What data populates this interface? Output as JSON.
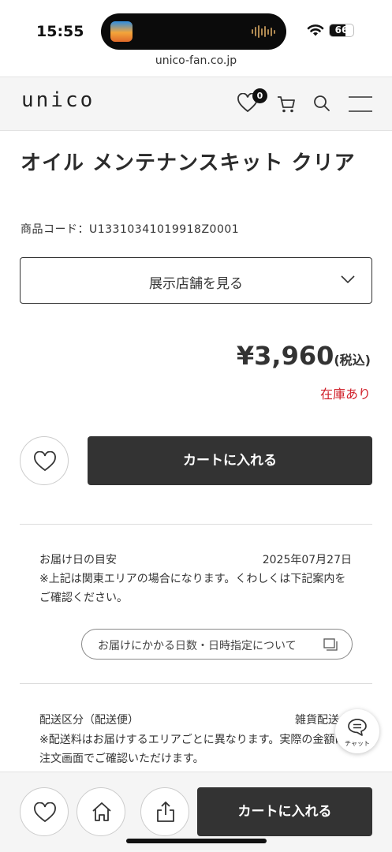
{
  "status_bar": {
    "time": "15:55",
    "battery_level": "66",
    "battery_fraction": 0.66
  },
  "browser": {
    "url": "unico-fan.co.jp"
  },
  "header": {
    "logo": "unico",
    "favorites_count": "0",
    "icons": [
      "heart-icon",
      "cart-icon",
      "search-icon",
      "menu-icon"
    ]
  },
  "product": {
    "title": "オイル メンテナンスキット クリア",
    "code": "商品コード：U13310341019918Z0001",
    "store_button_label": "展示店舗を見る",
    "price": "¥3,960",
    "tax_label": "(税込)",
    "stock_status": "在庫あり",
    "add_to_cart_label": "カートに入れる"
  },
  "delivery": {
    "estimate_label": "お届け日の目安",
    "estimate_date": "2025年07月27日",
    "estimate_note": "※上記は関東エリアの場合になります。くわしくは下記案内をご確認ください。",
    "info_link_label": "お届けにかかる日数・日時指定について",
    "shipping_label": "配送区分（配送便）",
    "shipping_value": "雑貨配送",
    "shipping_note": "※配送料はお届けするエリアごとに異なります。実際の金額は注文画面でご確認いただけます。"
  },
  "chat": {
    "label": "チャット"
  },
  "bottom_bar": {
    "add_to_cart_label": "カートに入れる",
    "icons": [
      "heart-icon",
      "home-icon",
      "share-icon"
    ]
  },
  "colors": {
    "primary_button": "#333333",
    "stock_red": "#d0202a",
    "header_bg": "#f5f5f5"
  }
}
